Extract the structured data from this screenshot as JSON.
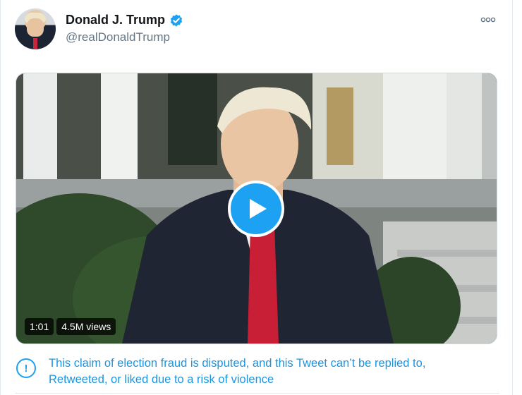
{
  "tweet": {
    "author_name": "Donald J. Trump",
    "handle": "@realDonaldTrump",
    "more_icon": "more-horizontal-icon",
    "verified_icon": "verified-badge-icon",
    "video": {
      "duration": "1:01",
      "views": "4.5M views",
      "play_icon": "play-icon"
    },
    "notice": {
      "icon": "exclamation-icon",
      "text": "This claim of election fraud is disputed, and this Tweet can’t be replied to, Retweeted, or liked due to a risk of violence"
    }
  },
  "colors": {
    "accent": "#1da1f2",
    "link": "#1b95e0",
    "muted": "#657786"
  }
}
